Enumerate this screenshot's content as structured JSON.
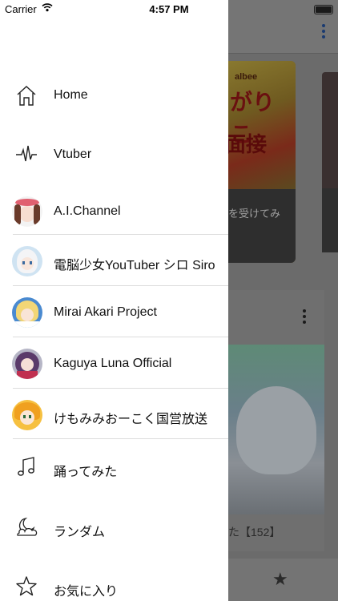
{
  "status_bar": {
    "carrier": "Carrier",
    "time": "4:57 PM"
  },
  "background": {
    "card_caption": "を受けてみ",
    "video_title": "た【152】",
    "card_art_line1": "albee",
    "card_art_line2": "がりこ",
    "card_art_line3": "面接"
  },
  "drawer": {
    "items": [
      {
        "label": "Home",
        "icon": "home-icon"
      },
      {
        "label": "Vtuber",
        "icon": "heartbeat-icon"
      },
      {
        "label": "A.I.Channel",
        "icon": "avatar"
      },
      {
        "label": "電脳少女YouTuber シロ Siro",
        "icon": "avatar"
      },
      {
        "label": "Mirai Akari Project",
        "icon": "avatar"
      },
      {
        "label": "Kaguya Luna Official",
        "icon": "avatar"
      },
      {
        "label": "けもみみおーこく国営放送",
        "icon": "avatar"
      },
      {
        "label": "踊ってみた",
        "icon": "music-note-icon"
      },
      {
        "label": "ランダム",
        "icon": "moon-cloud-icon"
      },
      {
        "label": "お気に入り",
        "icon": "star-icon"
      }
    ]
  },
  "colors": {
    "drawer_bg": "#ffffff",
    "overlay": "#6b6b6b",
    "divider": "#dcdcdc"
  }
}
